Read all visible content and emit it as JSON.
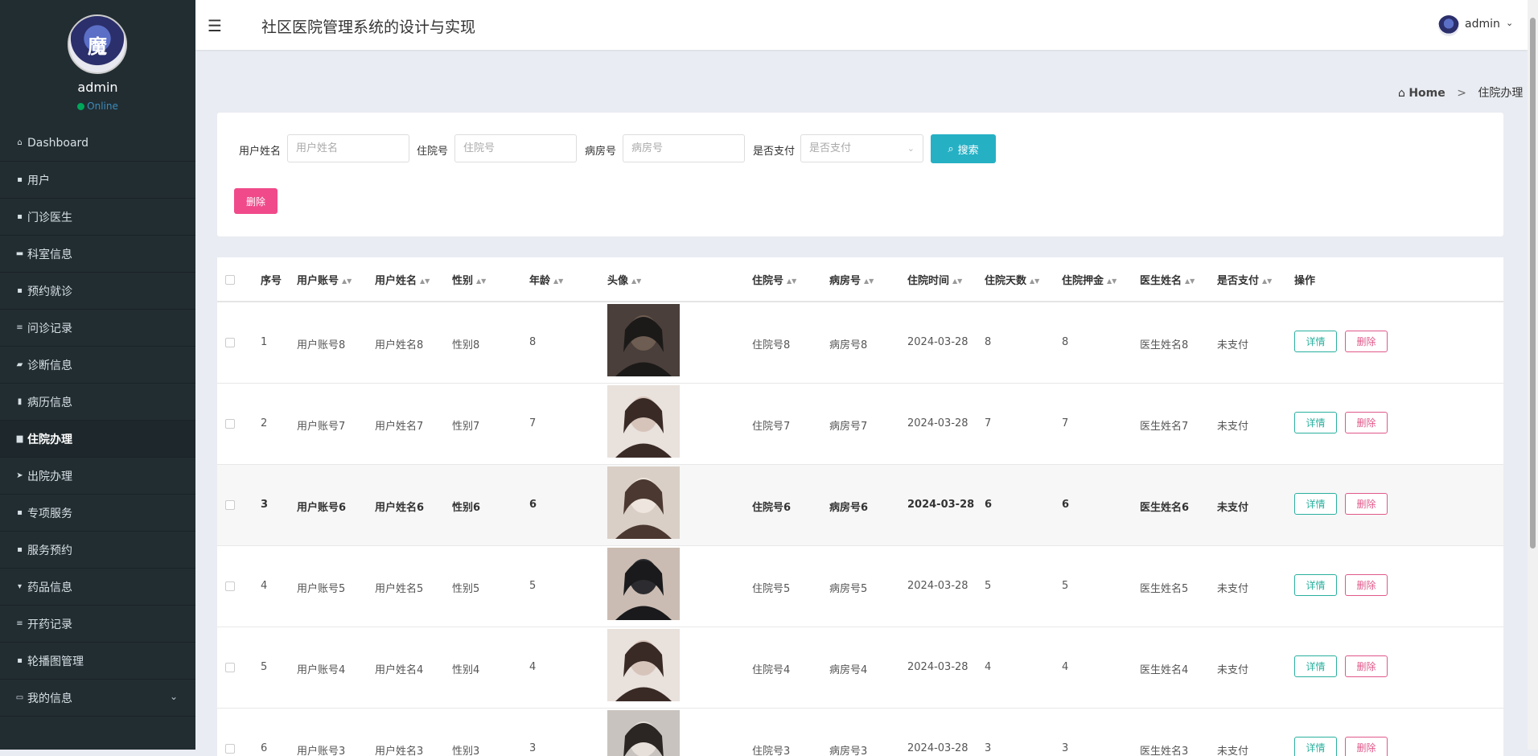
{
  "sidebar": {
    "user_name": "admin",
    "status": "Online",
    "items": [
      {
        "label": "Dashboard",
        "icon": "home-icon",
        "glyph": "⌂"
      },
      {
        "label": "用户",
        "icon": "grid-icon",
        "glyph": "▪"
      },
      {
        "label": "门诊医生",
        "icon": "grid-icon",
        "glyph": "▪"
      },
      {
        "label": "科室信息",
        "icon": "comment-icon",
        "glyph": "▬"
      },
      {
        "label": "预约就诊",
        "icon": "grid-icon",
        "glyph": "▪"
      },
      {
        "label": "问诊记录",
        "icon": "list-icon",
        "glyph": "≡"
      },
      {
        "label": "诊断信息",
        "icon": "ticket-icon",
        "glyph": "▰"
      },
      {
        "label": "病历信息",
        "icon": "bar-chart-icon",
        "glyph": "▮"
      },
      {
        "label": "住院办理",
        "icon": "bed-icon",
        "glyph": "▆"
      },
      {
        "label": "出院办理",
        "icon": "send-icon",
        "glyph": "➤"
      },
      {
        "label": "专项服务",
        "icon": "grid-icon",
        "glyph": "▪"
      },
      {
        "label": "服务预约",
        "icon": "clipboard-icon",
        "glyph": "▪"
      },
      {
        "label": "药品信息",
        "icon": "medicine-icon",
        "glyph": "▾"
      },
      {
        "label": "开药记录",
        "icon": "list-icon",
        "glyph": "≡"
      },
      {
        "label": "轮播图管理",
        "icon": "grid-icon",
        "glyph": "▪"
      },
      {
        "label": "我的信息",
        "icon": "card-icon",
        "glyph": "▭"
      }
    ],
    "active_index": 8
  },
  "header": {
    "title": "社区医院管理系统的设计与实现",
    "user": "admin"
  },
  "breadcrumb": {
    "home": "Home",
    "separator": ">",
    "current": "住院办理"
  },
  "search": {
    "name_label": "用户姓名",
    "name_placeholder": "用户姓名",
    "hosp_label": "住院号",
    "hosp_placeholder": "住院号",
    "room_label": "病房号",
    "room_placeholder": "病房号",
    "paid_label": "是否支付",
    "paid_placeholder": "是否支付",
    "search_button": "搜索",
    "delete_button": "删除"
  },
  "table": {
    "headers": {
      "index": "序号",
      "account": "用户账号",
      "name": "用户姓名",
      "gender": "性别",
      "age": "年龄",
      "avatar": "头像",
      "hosp_no": "住院号",
      "room_no": "病房号",
      "date": "住院时间",
      "days": "住院天数",
      "deposit": "住院押金",
      "doctor": "医生姓名",
      "paid": "是否支付",
      "actions": "操作"
    },
    "detail_label": "详情",
    "delete_label": "删除",
    "rows": [
      {
        "index": "1",
        "account": "用户账号8",
        "name": "用户姓名8",
        "gender": "性别8",
        "age": "8",
        "hosp_no": "住院号8",
        "room_no": "病房号8",
        "date": "2024-03-28",
        "days": "8",
        "deposit": "8",
        "doctor": "医生姓名8",
        "paid": "未支付"
      },
      {
        "index": "2",
        "account": "用户账号7",
        "name": "用户姓名7",
        "gender": "性别7",
        "age": "7",
        "hosp_no": "住院号7",
        "room_no": "病房号7",
        "date": "2024-03-28",
        "days": "7",
        "deposit": "7",
        "doctor": "医生姓名7",
        "paid": "未支付"
      },
      {
        "index": "3",
        "account": "用户账号6",
        "name": "用户姓名6",
        "gender": "性别6",
        "age": "6",
        "hosp_no": "住院号6",
        "room_no": "病房号6",
        "date": "2024-03-28",
        "days": "6",
        "deposit": "6",
        "doctor": "医生姓名6",
        "paid": "未支付"
      },
      {
        "index": "4",
        "account": "用户账号5",
        "name": "用户姓名5",
        "gender": "性别5",
        "age": "5",
        "hosp_no": "住院号5",
        "room_no": "病房号5",
        "date": "2024-03-28",
        "days": "5",
        "deposit": "5",
        "doctor": "医生姓名5",
        "paid": "未支付"
      },
      {
        "index": "5",
        "account": "用户账号4",
        "name": "用户姓名4",
        "gender": "性别4",
        "age": "4",
        "hosp_no": "住院号4",
        "room_no": "病房号4",
        "date": "2024-03-28",
        "days": "4",
        "deposit": "4",
        "doctor": "医生姓名4",
        "paid": "未支付"
      },
      {
        "index": "6",
        "account": "用户账号3",
        "name": "用户姓名3",
        "gender": "性别3",
        "age": "3",
        "hosp_no": "住院号3",
        "room_no": "病房号3",
        "date": "2024-03-28",
        "days": "3",
        "deposit": "3",
        "doctor": "医生姓名3",
        "paid": "未支付"
      }
    ]
  },
  "colors": {
    "sidebar_bg": "#222d32",
    "search_button": "#26b0c4",
    "delete_button": "#f04a8a",
    "detail_border": "#2ab09e",
    "delete_border": "#e0588a"
  }
}
